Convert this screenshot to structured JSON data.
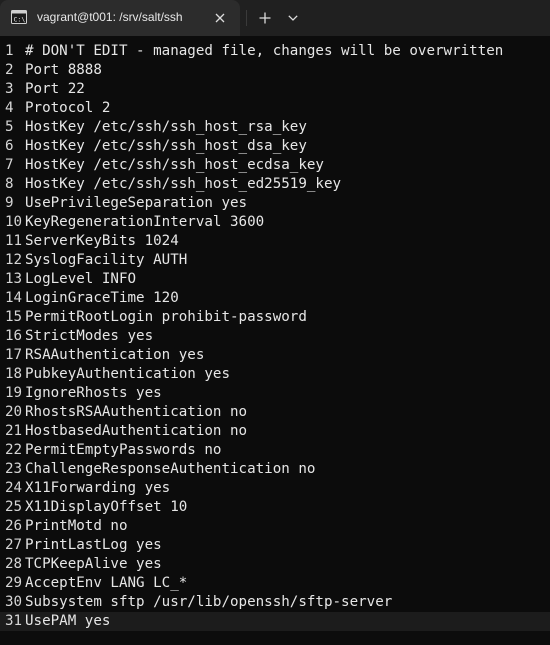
{
  "tab": {
    "title": "vagrant@t001: /srv/salt/ssh",
    "icon": "terminal-icon",
    "close": "✕",
    "new_tab": "+",
    "dropdown": "⌄"
  },
  "editor": {
    "lines": [
      {
        "n": "1",
        "text": "# DON'T EDIT - managed file, changes will be overwritten"
      },
      {
        "n": "2",
        "text": "Port 8888"
      },
      {
        "n": "3",
        "text": "Port 22"
      },
      {
        "n": "4",
        "text": "Protocol 2"
      },
      {
        "n": "5",
        "text": "HostKey /etc/ssh/ssh_host_rsa_key"
      },
      {
        "n": "6",
        "text": "HostKey /etc/ssh/ssh_host_dsa_key"
      },
      {
        "n": "7",
        "text": "HostKey /etc/ssh/ssh_host_ecdsa_key"
      },
      {
        "n": "8",
        "text": "HostKey /etc/ssh/ssh_host_ed25519_key"
      },
      {
        "n": "9",
        "text": "UsePrivilegeSeparation yes"
      },
      {
        "n": "10",
        "text": "KeyRegenerationInterval 3600"
      },
      {
        "n": "11",
        "text": "ServerKeyBits 1024"
      },
      {
        "n": "12",
        "text": "SyslogFacility AUTH"
      },
      {
        "n": "13",
        "text": "LogLevel INFO"
      },
      {
        "n": "14",
        "text": "LoginGraceTime 120"
      },
      {
        "n": "15",
        "text": "PermitRootLogin prohibit-password"
      },
      {
        "n": "16",
        "text": "StrictModes yes"
      },
      {
        "n": "17",
        "text": "RSAAuthentication yes"
      },
      {
        "n": "18",
        "text": "PubkeyAuthentication yes"
      },
      {
        "n": "19",
        "text": "IgnoreRhosts yes"
      },
      {
        "n": "20",
        "text": "RhostsRSAAuthentication no"
      },
      {
        "n": "21",
        "text": "HostbasedAuthentication no"
      },
      {
        "n": "22",
        "text": "PermitEmptyPasswords no"
      },
      {
        "n": "23",
        "text": "ChallengeResponseAuthentication no"
      },
      {
        "n": "24",
        "text": "X11Forwarding yes"
      },
      {
        "n": "25",
        "text": "X11DisplayOffset 10"
      },
      {
        "n": "26",
        "text": "PrintMotd no"
      },
      {
        "n": "27",
        "text": "PrintLastLog yes"
      },
      {
        "n": "28",
        "text": "TCPKeepAlive yes"
      },
      {
        "n": "29",
        "text": "AcceptEnv LANG LC_*"
      },
      {
        "n": "30",
        "text": "Subsystem sftp /usr/lib/openssh/sftp-server"
      },
      {
        "n": "31",
        "text": "UsePAM yes",
        "current": true
      }
    ]
  },
  "colors": {
    "background": "#0c0c0c",
    "foreground": "#e6e6e6",
    "tab_active": "#2c2c2c",
    "tabbar": "#202020"
  }
}
